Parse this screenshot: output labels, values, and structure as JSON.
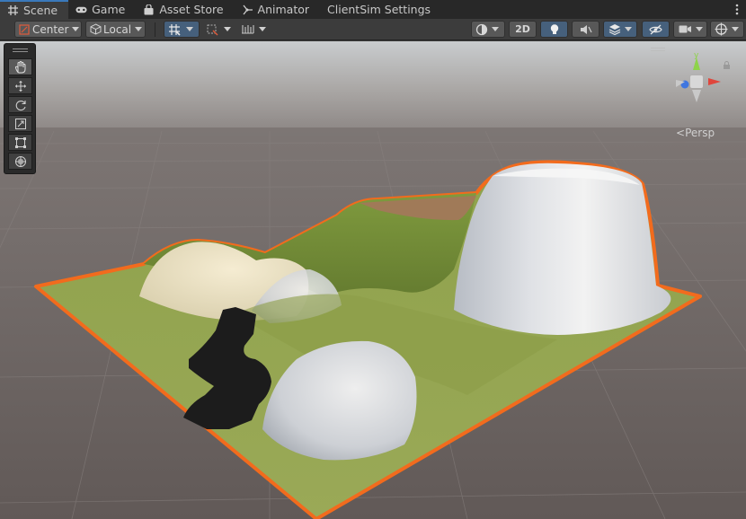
{
  "tabs": [
    {
      "label": "Scene",
      "icon": "grid-icon",
      "active": true
    },
    {
      "label": "Game",
      "icon": "gamepad-icon",
      "active": false
    },
    {
      "label": "Asset Store",
      "icon": "bag-icon",
      "active": false
    },
    {
      "label": "Animator",
      "icon": "animator-icon",
      "active": false
    },
    {
      "label": "ClientSim Settings",
      "icon": "",
      "active": false
    }
  ],
  "toolbar": {
    "pivot_label": "Center",
    "space_label": "Local",
    "mode_2d_label": "2D"
  },
  "gizmo": {
    "projection_label": "Persp",
    "axis_colors": {
      "x": "#e0463c",
      "y": "#8ed34a",
      "z": "#3f76e0"
    }
  },
  "terrain": {
    "selection_outline_color": "#f26b1d",
    "grass_color": "#8fa24c"
  }
}
